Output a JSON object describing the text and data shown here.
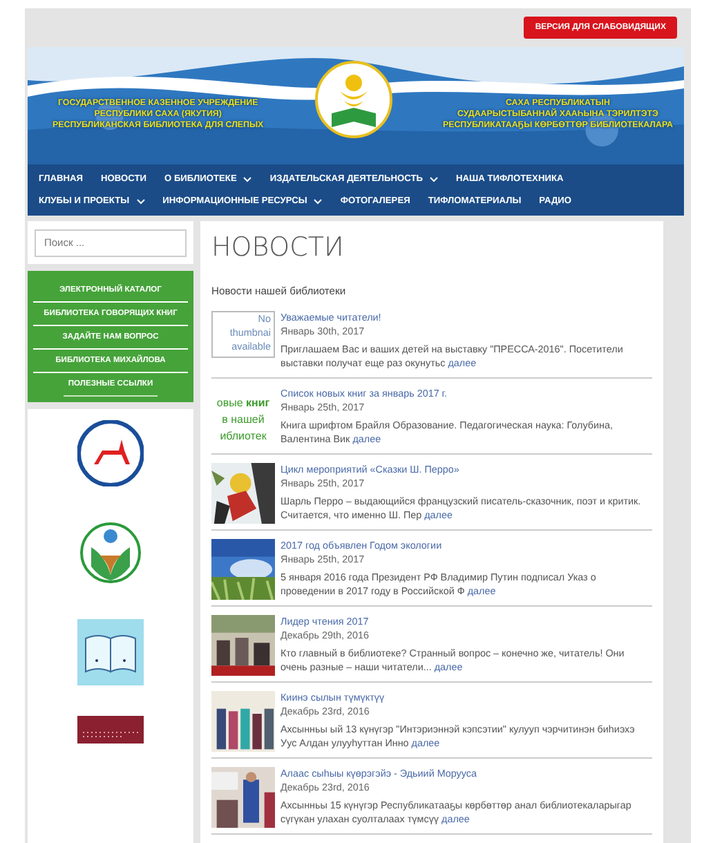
{
  "accessibility_button": "ВЕРСИЯ ДЛЯ СЛАБОВИДЯЩИХ",
  "banner": {
    "left_lines": [
      "ГОСУДАРСТВЕННОЕ КАЗЕННОЕ УЧРЕЖДЕНИЕ",
      "РЕСПУБЛИКИ САХА (ЯКУТИЯ)",
      "РЕСПУБЛИКАНСКАЯ БИБЛИОТЕКА ДЛЯ СЛЕПЫХ"
    ],
    "right_lines": [
      "САХА РЕСПУБЛИКАТЫН",
      "СУДААРЫСТЫБАННАЙ ХААҺЫНА ТЭРИЛТЭТЭ",
      "РЕСПУБЛИКАТААҔЫ КӨРБӨТТӨР БИБЛИОТЕКАЛАРА"
    ]
  },
  "nav": {
    "items": [
      {
        "label": "ГЛАВНАЯ",
        "has_submenu": false
      },
      {
        "label": "НОВОСТИ",
        "has_submenu": false
      },
      {
        "label": "О БИБЛИОТЕКЕ",
        "has_submenu": true
      },
      {
        "label": "ИЗДАТЕЛЬСКАЯ ДЕЯТЕЛЬНОСТЬ",
        "has_submenu": true
      },
      {
        "label": "НАША ТИФЛОТЕХНИКА",
        "has_submenu": false
      },
      {
        "label": "КЛУБЫ И ПРОЕКТЫ",
        "has_submenu": true
      },
      {
        "label": "ИНФОРМАЦИОННЫЕ РЕСУРСЫ",
        "has_submenu": true
      },
      {
        "label": "ФОТОГАЛЕРЕЯ",
        "has_submenu": false
      },
      {
        "label": "ТИФЛОМАТЕРИАЛЫ",
        "has_submenu": false
      },
      {
        "label": "РАДИО",
        "has_submenu": false
      }
    ]
  },
  "sidebar": {
    "search": {
      "placeholder": "Поиск ..."
    },
    "links": [
      "ЭЛЕКТРОННЫЙ КАТАЛОГ",
      "БИБЛИОТЕКА ГОВОРЯЩИХ КНИГ",
      "ЗАДАЙТЕ НАМ ВОПРОС",
      "БИБЛИОТЕКА МИХАЙЛОВА",
      "ПОЛЕЗНЫЕ ССЫЛКИ"
    ]
  },
  "content": {
    "title": "НОВОСТИ",
    "subtitle": "Новости нашей библиотеки",
    "posts": [
      {
        "title": "Уважаемые читатели!",
        "date": "Январь 30th, 2017",
        "excerpt": "Приглашаем Вас и ваших детей на выставку \"ПРЕССА-2016\". Посетители выставки получат еще раз окунутьс",
        "more": "далее",
        "thumb": {
          "kind": "broken",
          "lines": [
            "No",
            "thumbnai",
            "available"
          ]
        }
      },
      {
        "title": "Список новых книг за январь 2017 г.",
        "date": "Январь 25th, 2017",
        "excerpt": "Книга шрифтом Брайля Образование. Педагогическая наука:   Голубина, Валентина Вик",
        "more": "далее",
        "thumb": {
          "kind": "text",
          "lines": [
            "овые **книг**",
            "в нашей",
            "иблиотек"
          ]
        }
      },
      {
        "title": "Цикл мероприятий «Сказки Ш. Перро»",
        "date": "Январь 25th, 2017",
        "excerpt": "Шарль Перро – выдающийся французский писатель-сказочник, поэт и критик. Считается, что именно Ш. Пер",
        "more": "далее"
      },
      {
        "title": "2017 год объявлен Годом экологии",
        "date": "Январь 25th, 2017",
        "excerpt": "5 января 2016 года Президент РФ Владимир Путин подписал Указ о проведении в 2017 году в Российской Ф",
        "more": "далее"
      },
      {
        "title": "Лидер чтения 2017",
        "date": "Декабрь 29th, 2016",
        "excerpt": "Кто главный в библиотеке? Странный вопрос – конечно же, читатель! Они очень разные – наши читатели...",
        "more": "далее"
      },
      {
        "title": "Киинэ сылын түмүктүү",
        "date": "Декабрь 23rd, 2016",
        "excerpt": "Ахсынньы ый 13 күнүгэр \"Интэриэннэй кэпсэтии\" кулууп чэрчитинэн биһиэхэ Уус Алдан улууһуттан Инно",
        "more": "далее"
      },
      {
        "title": "Алаас сыһыы күөрэгэйэ - Эдьиий Моруусa",
        "date": "Декабрь 23rd, 2016",
        "excerpt": "Ахсынньы 15 күнүгэр Республикатааҕы көрбөттөр анал библиотекаларыгар сүгүкан улахан суолталаах түмсүү",
        "more": "далее"
      }
    ]
  }
}
